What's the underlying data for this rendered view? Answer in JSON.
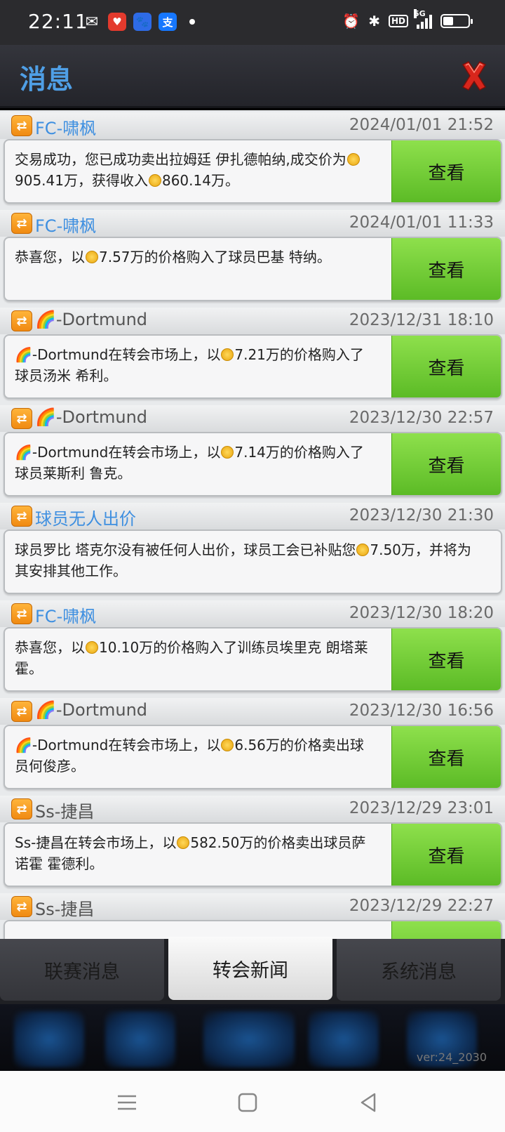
{
  "status_bar": {
    "time": "22:11",
    "network": "5G",
    "hd": "HD"
  },
  "header": {
    "title": "消息"
  },
  "messages": [
    {
      "sender": "FC-啸枫",
      "sender_color": "blue",
      "date": "2024/01/01 21:52",
      "text_a": "交易成功，您已成功卖出拉姆廷 伊扎德帕纳,成交价为",
      "text_b": "905.41万，获得收入",
      "text_c": "860.14万。",
      "has_button": true
    },
    {
      "sender": "FC-啸枫",
      "sender_color": "blue",
      "date": "2024/01/01 11:33",
      "text_a": "恭喜您，以",
      "text_b": "7.57万的价格购入了球员巴基 特纳。",
      "text_c": "",
      "has_button": true
    },
    {
      "sender": "🌈-Dortmund",
      "sender_color": "gray",
      "date": "2023/12/31 18:10",
      "text_a": "🌈-Dortmund在转会市场上，以",
      "text_b": "7.21万的价格购入了球员汤米 希利。",
      "text_c": "",
      "has_button": true
    },
    {
      "sender": "🌈-Dortmund",
      "sender_color": "gray",
      "date": "2023/12/30 22:57",
      "text_a": "🌈-Dortmund在转会市场上，以",
      "text_b": "7.14万的价格购入了球员莱斯利 鲁克。",
      "text_c": "",
      "has_button": true
    },
    {
      "sender": "球员无人出价",
      "sender_color": "blue",
      "date": "2023/12/30 21:30",
      "text_a": "球员罗比 塔克尔没有被任何人出价，球员工会已补贴您",
      "text_b": "7.50万，并将为其安排其他工作。",
      "text_c": "",
      "has_button": false
    },
    {
      "sender": "FC-啸枫",
      "sender_color": "blue",
      "date": "2023/12/30 18:20",
      "text_a": "恭喜您，以",
      "text_b": "10.10万的价格购入了训练员埃里克 朗塔莱霍。",
      "text_c": "",
      "has_button": true
    },
    {
      "sender": "🌈-Dortmund",
      "sender_color": "gray",
      "date": "2023/12/30 16:56",
      "text_a": "🌈-Dortmund在转会市场上，以",
      "text_b": "6.56万的价格卖出球员何俊彦。",
      "text_c": "",
      "has_button": true
    },
    {
      "sender": "Ss-捷昌",
      "sender_color": "gray",
      "date": "2023/12/29 23:01",
      "text_a": "Ss-捷昌在转会市场上，以",
      "text_b": "582.50万的价格卖出球员萨诺霍 霍德利。",
      "text_c": "",
      "has_button": true
    },
    {
      "sender": "Ss-捷昌",
      "sender_color": "gray",
      "date": "2023/12/29 22:27",
      "text_a": "",
      "text_b": "",
      "text_c": "",
      "has_button": true
    }
  ],
  "view_label": "查看",
  "tabs": [
    "联赛消息",
    "转会新闻",
    "系统消息"
  ],
  "active_tab": "转会新闻",
  "version": "ver:24_2030"
}
